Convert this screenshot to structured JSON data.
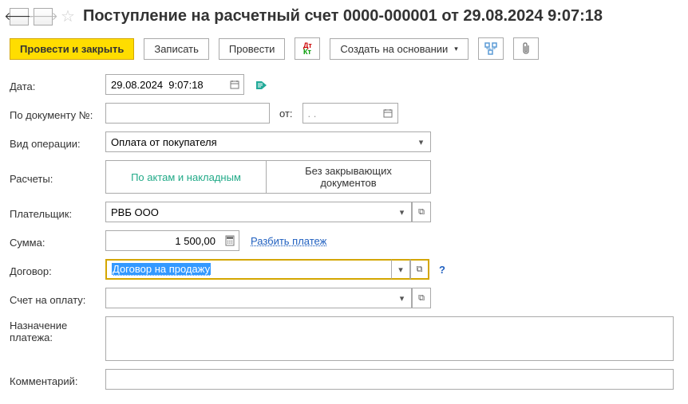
{
  "header": {
    "title": "Поступление на расчетный счет 0000-000001 от 29.08.2024 9:07:18"
  },
  "toolbar": {
    "post_close": "Провести и закрыть",
    "save": "Записать",
    "post": "Провести",
    "create_based": "Создать на основании",
    "caret": "▾"
  },
  "fields": {
    "date": {
      "label": "Дата:",
      "value": "29.08.2024  9:07:18"
    },
    "docnum": {
      "label": "По документу №:",
      "value": "",
      "ot": "от:",
      "ot_date": ". . "
    },
    "optype": {
      "label": "Вид операции:",
      "value": "Оплата от покупателя"
    },
    "calc": {
      "label": "Расчеты:",
      "opt1": "По актам и накладным",
      "opt2": "Без закрывающих документов"
    },
    "payer": {
      "label": "Плательщик:",
      "value": "РВБ ООО"
    },
    "amount": {
      "label": "Сумма:",
      "value": "1 500,00",
      "split": "Разбить платеж"
    },
    "contract": {
      "label": "Договор:",
      "value": "Договор на продажу"
    },
    "invoice": {
      "label": "Счет на оплату:",
      "value": ""
    },
    "purpose": {
      "label": "Назначение платежа:",
      "value": ""
    },
    "comment": {
      "label": "Комментарий:",
      "value": ""
    }
  },
  "glyphs": {
    "back": "🡐",
    "forward": "🡒",
    "star": "☆",
    "dropdown": "▾",
    "open": "⧉",
    "help": "?"
  }
}
